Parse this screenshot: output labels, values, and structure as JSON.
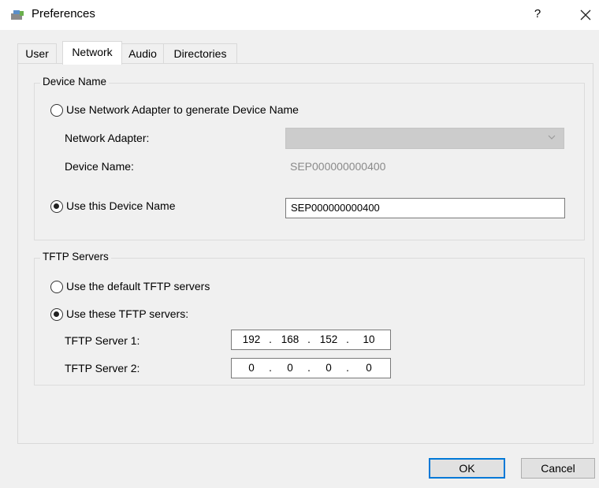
{
  "window": {
    "title": "Preferences",
    "help_label": "?",
    "close_label": "✕"
  },
  "tabs": [
    {
      "label": "User",
      "active": false
    },
    {
      "label": "Network",
      "active": true
    },
    {
      "label": "Audio",
      "active": false
    },
    {
      "label": "Directories",
      "active": false
    }
  ],
  "device_name": {
    "group_label": "Device Name",
    "option_adapter_label": "Use Network Adapter to generate Device Name",
    "option_adapter_checked": false,
    "network_adapter_label": "Network Adapter:",
    "network_adapter_value": "",
    "device_name_label": "Device Name:",
    "device_name_generated": "SEP000000000400",
    "option_custom_label": "Use this Device Name",
    "option_custom_checked": true,
    "custom_value": "SEP000000000400"
  },
  "tftp": {
    "group_label": "TFTP Servers",
    "option_default_label": "Use the default TFTP servers",
    "option_default_checked": false,
    "option_custom_label": "Use these TFTP servers:",
    "option_custom_checked": true,
    "server1_label": "TFTP Server 1:",
    "server1": [
      "192",
      "168",
      "152",
      "10"
    ],
    "server2_label": "TFTP Server 2:",
    "server2": [
      "0",
      "0",
      "0",
      "0"
    ]
  },
  "buttons": {
    "ok": "OK",
    "cancel": "Cancel"
  },
  "colors": {
    "accent": "#0078d7",
    "disabled_field": "#cccccc"
  }
}
